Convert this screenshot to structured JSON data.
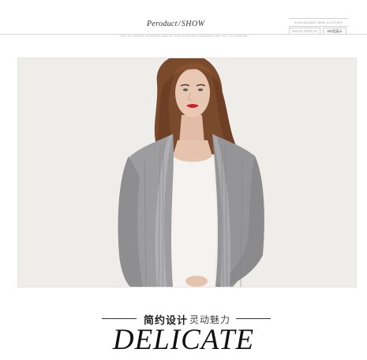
{
  "header": {
    "brand_word": "Peroduct",
    "brand_sep": "/",
    "brand_show": "SHOW",
    "tagline": "YOU TO CREATE ELEGANT AND STYLISH ELEGANT FASHION FOR YOU TO CHOOSE",
    "tag_line1": "2018 SEDATE NEW CLOTHES",
    "tag_line2_left": "IMAGE DISPLAY",
    "tag_line2_right": "360度展示"
  },
  "photo": {
    "subject": "model wearing grey knit cardigan over white top",
    "colors": {
      "background": "#efedea",
      "cardigan": "#9a9a9c",
      "top": "#f4f3f0",
      "hair": "#7a4a2c",
      "lips": "#c8232c",
      "skin": "#e6c3ad"
    }
  },
  "caption": {
    "cn_bold": "简约设计",
    "cn_light": "灵动魅力",
    "big_word": "DELICATE"
  }
}
